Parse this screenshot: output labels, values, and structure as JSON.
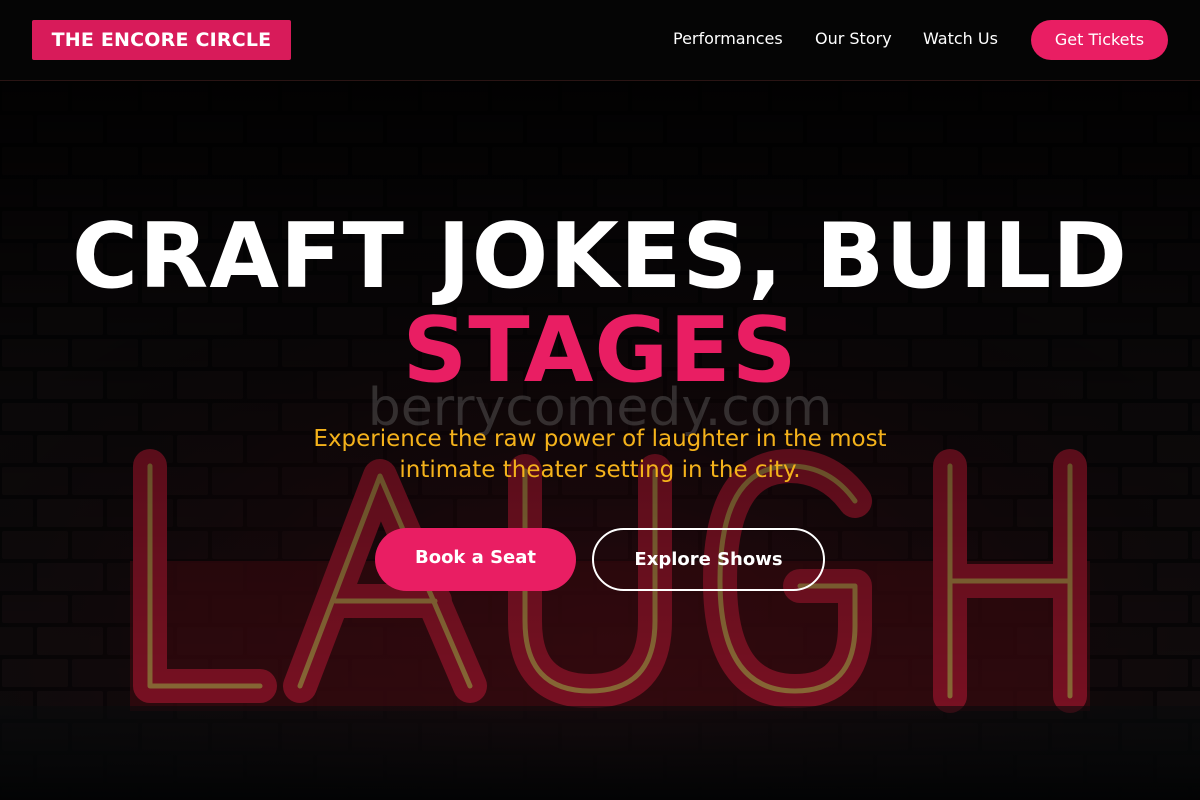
{
  "header": {
    "brand": "THE ENCORE CIRCLE",
    "nav": [
      "Performances",
      "Our Story",
      "Watch Us"
    ],
    "cta_label": "Get Tickets"
  },
  "hero": {
    "headline_line1": "CRAFT JOKES, BUILD",
    "headline_line2": "STAGES",
    "watermark": "berrycomedy.com",
    "subtitle": "Experience the raw power of laughter in the most intimate theater setting in the city.",
    "primary_button": "Book a Seat",
    "secondary_button": "Explore Shows",
    "background_image": "neon-laugh-sign-on-brick-wall",
    "neon_sign_text": "LAUGH"
  },
  "colors": {
    "accent": "#e91e63",
    "subtitle": "#f4b21b",
    "background": "#050505",
    "neon_red": "#c81d3a",
    "neon_yellow": "#f3d36a"
  }
}
